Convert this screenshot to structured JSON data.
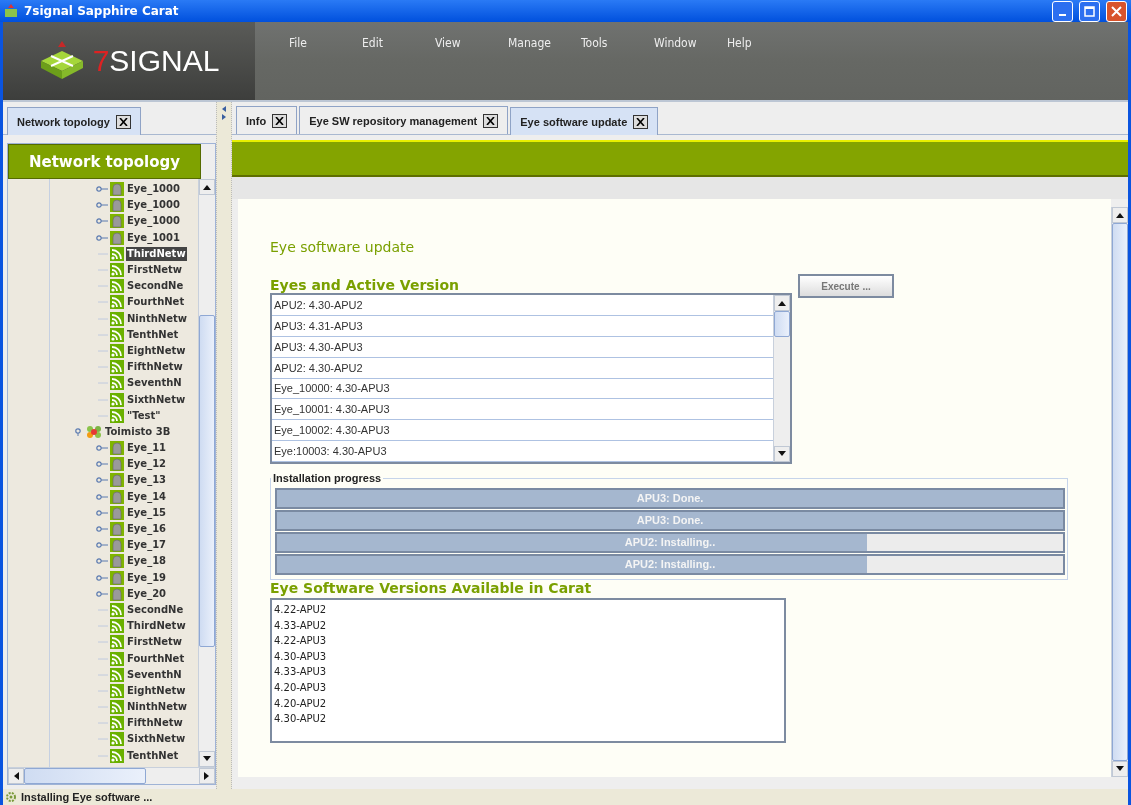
{
  "window": {
    "title": "7signal Sapphire Carat"
  },
  "logo": {
    "digit": "7",
    "word": "SIGNAL"
  },
  "menu": [
    "File",
    "Edit",
    "View",
    "Manage",
    "Tools",
    "Window",
    "Help"
  ],
  "left_tabs": [
    {
      "label": "Network topology",
      "selected": true
    }
  ],
  "left_panel": {
    "title": "Network topology"
  },
  "tree": {
    "continued_items": [
      {
        "label": "Eye_1000",
        "kind": "eye",
        "expanded": false
      },
      {
        "label": "Eye_1000",
        "kind": "eye",
        "expanded": false
      },
      {
        "label": "Eye_1000",
        "kind": "eye",
        "expanded": false
      },
      {
        "label": "Eye_1001",
        "kind": "eye",
        "expanded": false
      },
      {
        "label": "ThirdNetw",
        "kind": "network",
        "selected": true
      },
      {
        "label": "FirstNetw",
        "kind": "network",
        "selected": false
      },
      {
        "label": "SecondNe",
        "kind": "network",
        "selected": false
      },
      {
        "label": "FourthNet",
        "kind": "network",
        "selected": false
      },
      {
        "label": "NinthNetw",
        "kind": "network",
        "selected": false
      },
      {
        "label": "TenthNet",
        "kind": "network",
        "selected": false
      },
      {
        "label": "EightNetw",
        "kind": "network",
        "selected": false
      },
      {
        "label": "FifthNetw",
        "kind": "network",
        "selected": false
      },
      {
        "label": "SeventhN",
        "kind": "network",
        "selected": false
      },
      {
        "label": "SixthNetw",
        "kind": "network",
        "selected": false
      },
      {
        "label": "\"Test\"",
        "kind": "network",
        "selected": false
      }
    ],
    "nodes": [
      {
        "label": "Toimisto 3B",
        "kind": "site",
        "expanded": true,
        "children": [
          {
            "label": "Eye_11",
            "kind": "eye",
            "expanded": false
          },
          {
            "label": "Eye_12",
            "kind": "eye",
            "expanded": false
          },
          {
            "label": "Eye_13",
            "kind": "eye",
            "expanded": false
          },
          {
            "label": "Eye_14",
            "kind": "eye",
            "expanded": false
          },
          {
            "label": "Eye_15",
            "kind": "eye",
            "expanded": false
          },
          {
            "label": "Eye_16",
            "kind": "eye",
            "expanded": false
          },
          {
            "label": "Eye_17",
            "kind": "eye",
            "expanded": false
          },
          {
            "label": "Eye_18",
            "kind": "eye",
            "expanded": false
          },
          {
            "label": "Eye_19",
            "kind": "eye",
            "expanded": false
          },
          {
            "label": "Eye_20",
            "kind": "eye",
            "expanded": false
          },
          {
            "label": "SecondNe",
            "kind": "network",
            "selected": false
          },
          {
            "label": "ThirdNetw",
            "kind": "network",
            "selected": false
          },
          {
            "label": "FirstNetw",
            "kind": "network",
            "selected": false
          },
          {
            "label": "FourthNet",
            "kind": "network",
            "selected": false
          },
          {
            "label": "SeventhN",
            "kind": "network",
            "selected": false
          },
          {
            "label": "EightNetw",
            "kind": "network",
            "selected": false
          },
          {
            "label": "NinthNetw",
            "kind": "network",
            "selected": false
          },
          {
            "label": "FifthNetw",
            "kind": "network",
            "selected": false
          },
          {
            "label": "SixthNetw",
            "kind": "network",
            "selected": false
          },
          {
            "label": "TenthNet",
            "kind": "network",
            "selected": false
          }
        ]
      }
    ]
  },
  "tabs": [
    {
      "label": "Info",
      "selected": false
    },
    {
      "label": "Eye SW repository management",
      "selected": false
    },
    {
      "label": "Eye software update",
      "selected": true
    }
  ],
  "page": {
    "title": "Eye software update",
    "eyes_heading": "Eyes and Active Version",
    "execute_button": "Execute ...",
    "eyes": [
      "APU2: 4.30-APU2",
      "APU3: 4.31-APU3",
      "APU3: 4.30-APU3",
      "APU2: 4.30-APU2",
      "Eye_10000: 4.30-APU3",
      "Eye_10001: 4.30-APU3",
      "Eye_10002: 4.30-APU3",
      "Eye:10003: 4.30-APU3"
    ],
    "progress_title": "Installation progress",
    "progress": [
      {
        "text": "APU3: Done.",
        "level": 1
      },
      {
        "text": "APU3: Done.",
        "level": 1
      },
      {
        "text": "APU2: Installing..",
        "level": 0.75
      },
      {
        "text": "APU2: Installing..",
        "level": 0.75
      }
    ],
    "versions_heading": "Eye Software Versions Available in Carat",
    "versions": [
      "4.22-APU2",
      "4.33-APU2",
      "4.22-APU3",
      "4.30-APU3",
      "4.33-APU3",
      "4.20-APU3",
      "4.20-APU2",
      "4.30-APU2"
    ]
  },
  "status_bar": {
    "text": "Installing Eye software ..."
  }
}
